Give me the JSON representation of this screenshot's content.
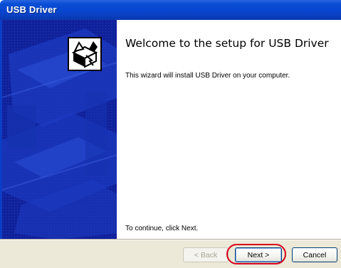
{
  "window": {
    "title": "USB Driver"
  },
  "welcome": {
    "heading": "Welcome to the setup for USB Driver",
    "description": "This wizard will install USB Driver on your computer.",
    "continue_text": "To continue, click Next."
  },
  "buttons": {
    "back_label": "< Back",
    "next_label": "Next >",
    "cancel_label": "Cancel"
  },
  "icons": {
    "wizard_image": "setup-box-icon"
  },
  "colors": {
    "titlebar": "#0846d0",
    "left_panel": "#10219c",
    "footer": "#ece9d8",
    "highlight_ring": "#d8001a"
  }
}
